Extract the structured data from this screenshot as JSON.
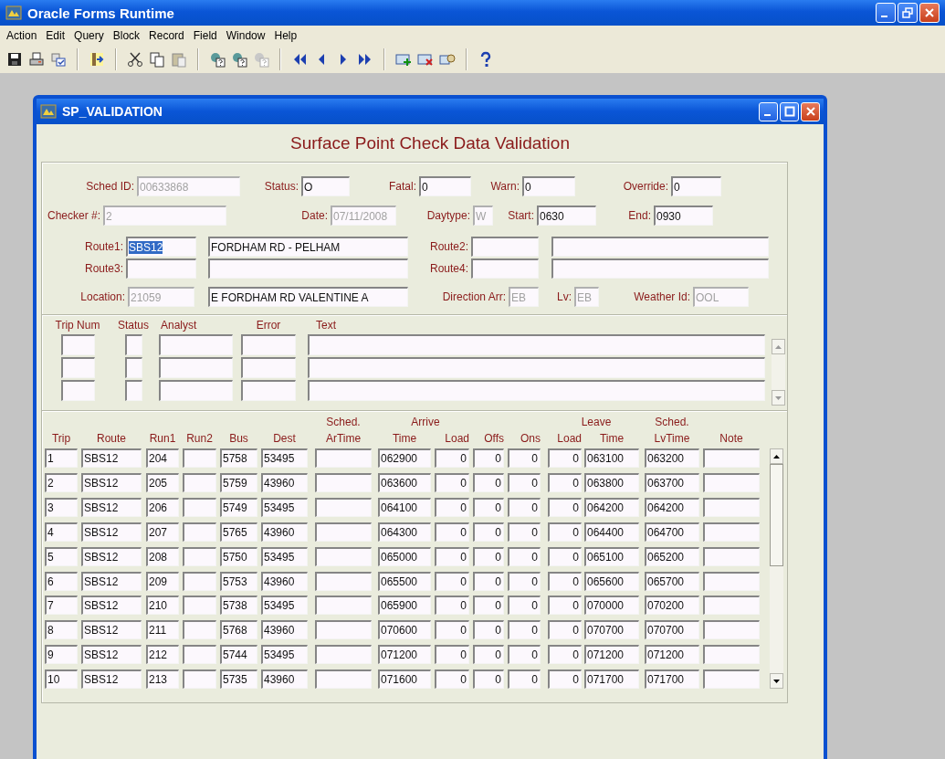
{
  "app": {
    "title": "Oracle Forms Runtime"
  },
  "menu": [
    "Action",
    "Edit",
    "Query",
    "Block",
    "Record",
    "Field",
    "Window",
    "Help"
  ],
  "window": {
    "title": "SP_VALIDATION"
  },
  "form_title": "Surface Point Check Data Validation",
  "header_rows": [
    [
      {
        "kind": "labeled",
        "label": "Sched ID:",
        "value": "00633868",
        "disabled": true,
        "highlighted": false
      },
      {
        "kind": "labeled",
        "label": "Status:",
        "value": "O",
        "disabled": false,
        "highlighted": false
      },
      {
        "kind": "labeled",
        "label": "Fatal:",
        "value": "0",
        "disabled": false,
        "highlighted": false
      },
      {
        "kind": "labeled",
        "label": "Warn:",
        "value": "0",
        "disabled": false,
        "highlighted": false
      },
      {
        "kind": "labeled",
        "label": "Override:",
        "value": "0",
        "disabled": false,
        "highlighted": false
      }
    ],
    [
      {
        "kind": "labeled",
        "label": "Checker #:",
        "value": "2",
        "disabled": true,
        "highlighted": false
      },
      {
        "kind": "labeled",
        "label": "Date:",
        "value": "07/11/2008",
        "disabled": true,
        "highlighted": false
      },
      {
        "kind": "labeled",
        "label": "Daytype:",
        "value": "W",
        "disabled": true,
        "highlighted": false
      },
      {
        "kind": "labeled",
        "label": "Start:",
        "value": "0630",
        "disabled": false,
        "highlighted": false
      },
      {
        "kind": "labeled",
        "label": "End:",
        "value": "0930",
        "disabled": false,
        "highlighted": false
      }
    ],
    [
      {
        "kind": "labeled",
        "label": "Route1:",
        "value": "SBS12",
        "disabled": false,
        "highlighted": true
      },
      {
        "kind": "plain",
        "value": "FORDHAM RD - PELHAM",
        "disabled": false,
        "highlighted": false
      },
      {
        "kind": "labeled",
        "label": "Route2:",
        "disabled": false
      },
      {
        "kind": "plain",
        "disabled": false
      }
    ],
    [
      {
        "kind": "labeled",
        "label": "Route3:",
        "disabled": false
      },
      {
        "kind": "plain",
        "disabled": false
      },
      {
        "kind": "labeled",
        "label": "Route4:",
        "disabled": false
      },
      {
        "kind": "plain",
        "disabled": false
      }
    ],
    [
      {
        "kind": "labeled",
        "label": "Location:",
        "value": "21059",
        "disabled": true,
        "highlighted": false
      },
      {
        "kind": "plain",
        "value": "E FORDHAM RD VALENTINE A",
        "disabled": false,
        "highlighted": false
      },
      {
        "kind": "labeled",
        "label": "Direction Arr:",
        "value": "EB",
        "disabled": true,
        "highlighted": false
      },
      {
        "kind": "labeled",
        "label": "Lv:",
        "value": "EB",
        "disabled": true,
        "highlighted": false
      },
      {
        "kind": "labeled",
        "label": "Weather Id:",
        "value": "OOL",
        "disabled": true,
        "highlighted": false
      }
    ]
  ],
  "trip_errors": {
    "columns": [
      "Trip Num",
      "Status",
      "Analyst",
      "Error",
      "Text"
    ],
    "rows": [
      [
        null,
        null,
        null,
        null,
        null
      ],
      [
        null,
        null,
        null,
        null,
        null
      ],
      [
        null,
        null,
        null,
        null,
        null
      ]
    ]
  },
  "table": {
    "header": [
      {
        "kind": "column",
        "label": "Trip",
        "numeric": false
      },
      {
        "kind": "column",
        "label": "Route",
        "numeric": false
      },
      {
        "kind": "column",
        "label": "Run1",
        "numeric": false
      },
      {
        "kind": "column",
        "label": "Run2",
        "numeric": false
      },
      {
        "kind": "column",
        "label": "Bus",
        "numeric": false
      },
      {
        "kind": "column",
        "label": "Dest",
        "numeric": false
      },
      {
        "kind": "column",
        "top": "Sched.",
        "label": "ArTime",
        "numeric": false
      },
      {
        "kind": "group",
        "label": "Arrive",
        "columns": [
          {
            "label": "Time",
            "numeric": false
          },
          {
            "label": "Load",
            "numeric": true
          }
        ]
      },
      {
        "kind": "column",
        "label": "Offs",
        "numeric": true
      },
      {
        "kind": "column",
        "label": "Ons",
        "numeric": true
      },
      {
        "kind": "group",
        "label": "Leave",
        "columns": [
          {
            "label": "Load",
            "numeric": true
          },
          {
            "label": "Time",
            "numeric": false
          }
        ]
      },
      {
        "kind": "column",
        "top": "Sched.",
        "label": "LvTime",
        "numeric": false
      },
      {
        "kind": "column",
        "label": "Note",
        "numeric": false
      }
    ],
    "rows": [
      [
        "1",
        "SBS12",
        "204",
        null,
        "5758",
        "53495",
        null,
        "062900",
        "0",
        "0",
        "0",
        "0",
        "063100",
        "063200",
        null
      ],
      [
        "2",
        "SBS12",
        "205",
        null,
        "5759",
        "43960",
        null,
        "063600",
        "0",
        "0",
        "0",
        "0",
        "063800",
        "063700",
        null
      ],
      [
        "3",
        "SBS12",
        "206",
        null,
        "5749",
        "53495",
        null,
        "064100",
        "0",
        "0",
        "0",
        "0",
        "064200",
        "064200",
        null
      ],
      [
        "4",
        "SBS12",
        "207",
        null,
        "5765",
        "43960",
        null,
        "064300",
        "0",
        "0",
        "0",
        "0",
        "064400",
        "064700",
        null
      ],
      [
        "5",
        "SBS12",
        "208",
        null,
        "5750",
        "53495",
        null,
        "065000",
        "0",
        "0",
        "0",
        "0",
        "065100",
        "065200",
        null
      ],
      [
        "6",
        "SBS12",
        "209",
        null,
        "5753",
        "43960",
        null,
        "065500",
        "0",
        "0",
        "0",
        "0",
        "065600",
        "065700",
        null
      ],
      [
        "7",
        "SBS12",
        "210",
        null,
        "5738",
        "53495",
        null,
        "065900",
        "0",
        "0",
        "0",
        "0",
        "070000",
        "070200",
        null
      ],
      [
        "8",
        "SBS12",
        "211",
        null,
        "5768",
        "43960",
        null,
        "070600",
        "0",
        "0",
        "0",
        "0",
        "070700",
        "070700",
        null
      ],
      [
        "9",
        "SBS12",
        "212",
        null,
        "5744",
        "53495",
        null,
        "071200",
        "0",
        "0",
        "0",
        "0",
        "071200",
        "071200",
        null
      ],
      [
        "10",
        "SBS12",
        "213",
        null,
        "5735",
        "43960",
        null,
        "071600",
        "0",
        "0",
        "0",
        "0",
        "071700",
        "071700",
        null
      ]
    ]
  }
}
